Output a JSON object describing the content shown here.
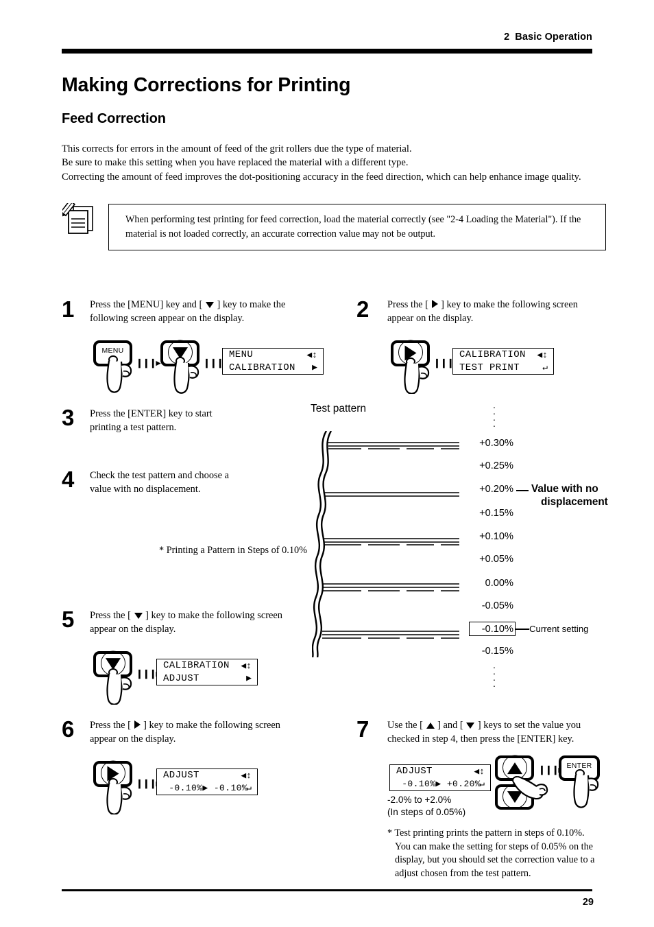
{
  "header": {
    "chapter_number": "2",
    "chapter_title": "Basic Operation"
  },
  "footer": {
    "page_number": "29"
  },
  "titles": {
    "h1": "Making Corrections for Printing",
    "h2": "Feed Correction"
  },
  "intro": {
    "line1": "This corrects for errors in the amount of feed of the grit rollers due the type of material.",
    "line2": "Be sure to make this setting when you have replaced the material with a different type.",
    "line3": "Correcting the amount of feed improves the dot-positioning accuracy in the feed direction, which can help enhance image quality."
  },
  "note": {
    "icon": "note-pencil-icon",
    "text": "When performing test printing for feed correction, load the material correctly (see \"2-4  Loading the Material\").  If the material is not loaded correctly, an accurate correction value may not be output."
  },
  "steps": [
    {
      "number": "1",
      "text_line1": "Press the [MENU] key and [ ▼ ] key to make the",
      "text_line2": "following screen appear on the display.",
      "keys": [
        "MENU",
        "down-arrow"
      ],
      "lcd": {
        "line1_left": "MENU",
        "line1_right": "◀↕",
        "line2_left": "CALIBRATION",
        "line2_right": "▶"
      }
    },
    {
      "number": "2",
      "text_line1": "Press the [ ▶ ] key to make the following screen",
      "text_line2": "appear on the display.",
      "keys": [
        "right-arrow"
      ],
      "lcd": {
        "line1_left": "CALIBRATION",
        "line1_right": "◀↕",
        "line2_left": "TEST PRINT",
        "line2_right": "↵"
      }
    },
    {
      "number": "3",
      "text_line1": "Press the [ENTER] key to start",
      "text_line2": "printing a test pattern."
    },
    {
      "number": "4",
      "text_line1": "Check the test pattern and choose a",
      "text_line2": "value with no displacement."
    },
    {
      "number": "5",
      "text_line1": "Press the [ ▼ ] key to make the following screen",
      "text_line2": "appear on the display.",
      "keys": [
        "down-arrow"
      ],
      "lcd": {
        "line1_left": "CALIBRATION",
        "line1_right": "◀↕",
        "line2_left": "ADJUST",
        "line2_right": "▶"
      }
    },
    {
      "number": "6",
      "text_line1": "Press the [ ▶ ] key to make the following screen",
      "text_line2": "appear on the display.",
      "keys": [
        "right-arrow"
      ],
      "lcd": {
        "line1_left": "ADJUST",
        "line1_right": "◀↕",
        "line2_left": " -0.10%▶ -0.10%",
        "line2_right": "↵"
      }
    },
    {
      "number": "7",
      "text_line1": "Use the [ ▲ ] and [ ▼ ] keys to set the value you",
      "text_line2": "checked in step 4, then press the [ENTER] key.",
      "keys": [
        "up-arrow",
        "down-arrow",
        "ENTER"
      ],
      "lcd": {
        "line1_left": "ADJUST",
        "line1_right": "◀↕",
        "line2_left": " -0.10%▶ +0.20%",
        "line2_right": "↵"
      },
      "range_line1": "-2.0% to +2.0%",
      "range_line2": "(In steps of 0.05%)"
    }
  ],
  "pattern_note": "* Printing a Pattern in Steps of 0.10%",
  "test_pattern": {
    "title": "Test pattern",
    "top_ellipsis": "·",
    "bottom_ellipsis": "·",
    "labels": [
      {
        "value": "+0.30%",
        "printed": true
      },
      {
        "value": "+0.25%",
        "printed": false
      },
      {
        "value": "+0.20%",
        "printed": true
      },
      {
        "value": "+0.15%",
        "printed": false
      },
      {
        "value": "+0.10%",
        "printed": true
      },
      {
        "value": "+0.05%",
        "printed": false
      },
      {
        "value": "0.00%",
        "printed": true
      },
      {
        "value": "-0.05%",
        "printed": false
      },
      {
        "value": "-0.10%",
        "printed": true
      },
      {
        "value": "-0.15%",
        "printed": false
      }
    ],
    "annotation_no_displacement_line1": "Value with no",
    "annotation_no_displacement_line2": "displacement",
    "annotation_current_setting": "Current setting",
    "current_setting_value": "-0.10%",
    "no_displacement_value": "+0.20%"
  },
  "footnote": {
    "line1": "* Test printing prints the pattern in steps of 0.10%.",
    "line2": "You can make the setting for steps of 0.05% on the",
    "line3": "display, but you should set the correction value to a",
    "line4": "adjust chosen from the test pattern."
  },
  "separator_glyph": "❙❙❙▸"
}
